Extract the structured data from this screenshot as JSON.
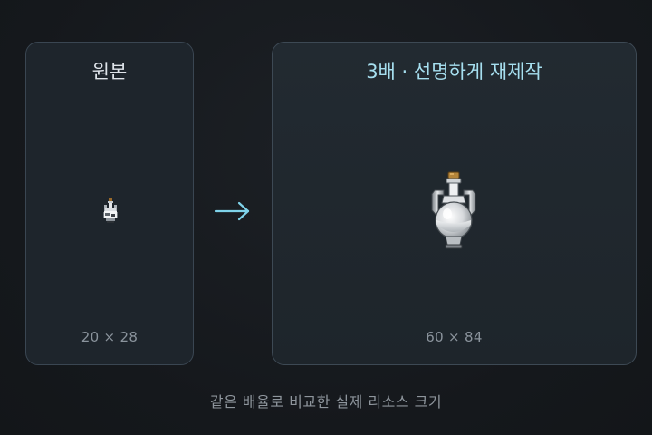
{
  "original_panel": {
    "title": "원본",
    "dimensions": "20 × 28",
    "sprite_icon": "potion-bottle-icon"
  },
  "arrow_icon": "right-arrow-icon",
  "arrow_color": "#7fd3ea",
  "remade_panel": {
    "title": "3배 · 선명하게 재제작",
    "dimensions": "60 × 84",
    "sprite_icon": "potion-bottle-icon",
    "title_color": "#a6dfef"
  },
  "caption": "같은 배율로 비교한 실제 리소스 크기"
}
